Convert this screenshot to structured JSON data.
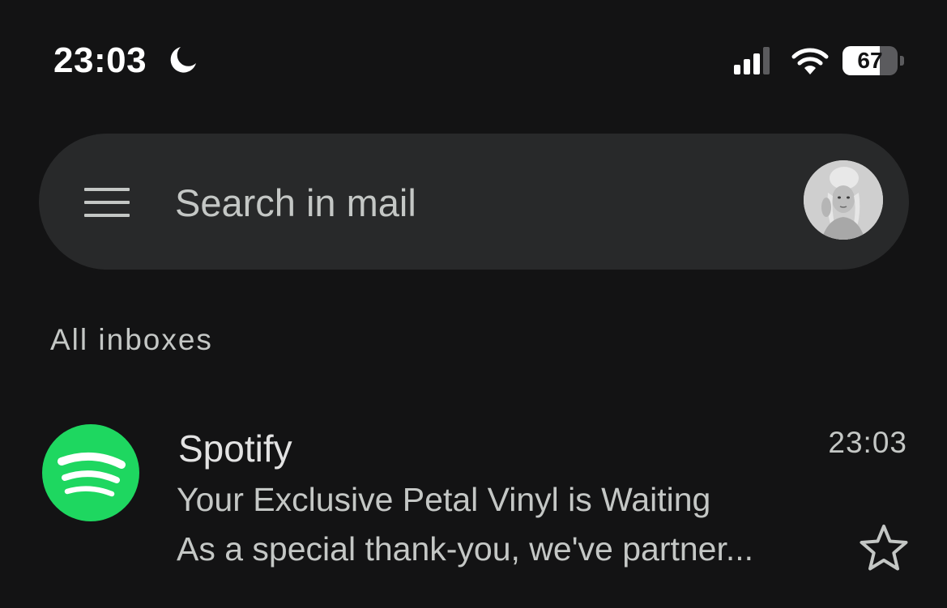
{
  "status_bar": {
    "time": "23:03",
    "battery_level": "67",
    "icons": [
      "moon-icon",
      "signal-icon",
      "wifi-icon",
      "battery-icon"
    ]
  },
  "search": {
    "placeholder": "Search in mail",
    "menu_icon": "hamburger-menu-icon",
    "avatar_icon": "account-avatar"
  },
  "section": {
    "label": "All inboxes"
  },
  "emails": [
    {
      "sender": "Spotify",
      "time": "23:03",
      "subject": "Your Exclusive Petal Vinyl is Waiting",
      "snippet": "As a special thank-you, we've partner...",
      "avatar_icon": "spotify-logo-icon",
      "starred": false
    }
  ],
  "colors": {
    "background": "#131314",
    "search_bar": "#28292a",
    "primary_text": "#e3e3e3",
    "secondary_text": "#c4c7c5",
    "spotify_green": "#1ed760"
  }
}
